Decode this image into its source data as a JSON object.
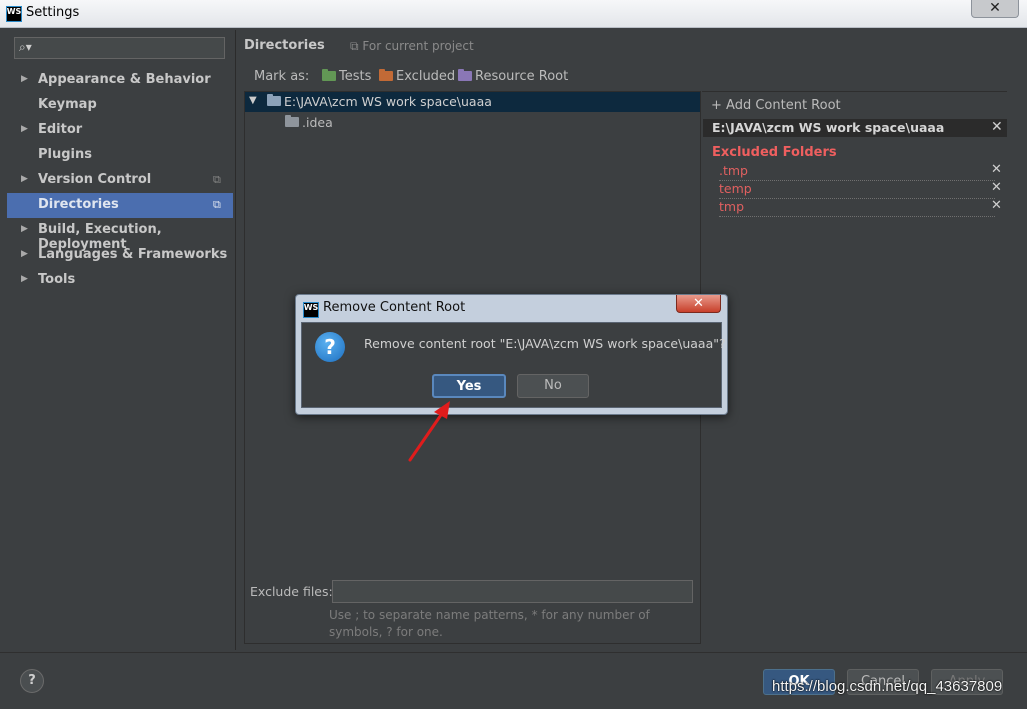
{
  "window": {
    "title": "Settings",
    "logo": "WS"
  },
  "search": {
    "placeholder": "",
    "icon": "search-icon"
  },
  "sidebar": {
    "items": [
      {
        "label": "Appearance & Behavior",
        "expandable": true
      },
      {
        "label": "Keymap",
        "expandable": false
      },
      {
        "label": "Editor",
        "expandable": true
      },
      {
        "label": "Plugins",
        "expandable": false
      },
      {
        "label": "Version Control",
        "expandable": true
      },
      {
        "label": "Directories",
        "expandable": false,
        "active": true
      },
      {
        "label": "Build, Execution, Deployment",
        "expandable": true
      },
      {
        "label": "Languages & Frameworks",
        "expandable": true
      },
      {
        "label": "Tools",
        "expandable": true
      }
    ]
  },
  "header": {
    "title": "Directories",
    "scope": "For current project"
  },
  "mark_as": {
    "label": "Mark as:",
    "tests": "Tests",
    "excluded": "Excluded",
    "resource_root": "Resource Root"
  },
  "tree": {
    "root": "E:\\JAVA\\zcm WS work space\\uaaa",
    "child": ".idea"
  },
  "exclude_files": {
    "label": "Exclude files:",
    "value": "",
    "hint_line1": "Use ; to separate name patterns, * for any number of",
    "hint_line2": "symbols, ? for one."
  },
  "content_root": {
    "add_label": "Add Content Root",
    "path": "E:\\JAVA\\zcm WS work space\\uaaa",
    "excluded_heading": "Excluded Folders",
    "excluded": [
      ".tmp",
      "temp",
      "tmp"
    ]
  },
  "footer": {
    "ok": "OK",
    "cancel": "Cancel",
    "apply": "Apply"
  },
  "dialog": {
    "title": "Remove Content Root",
    "message": "Remove content root \"E:\\JAVA\\zcm WS work space\\uaaa\"?",
    "yes": "Yes",
    "no": "No"
  },
  "watermark": "https://blog.csdn.net/qq_43637809",
  "colors": {
    "accent": "#4b6eaf",
    "tests_folder": "#629755",
    "excluded_folder": "#c26a36",
    "resource_folder": "#8a77b6",
    "excluded_text": "#ef5f5f"
  }
}
